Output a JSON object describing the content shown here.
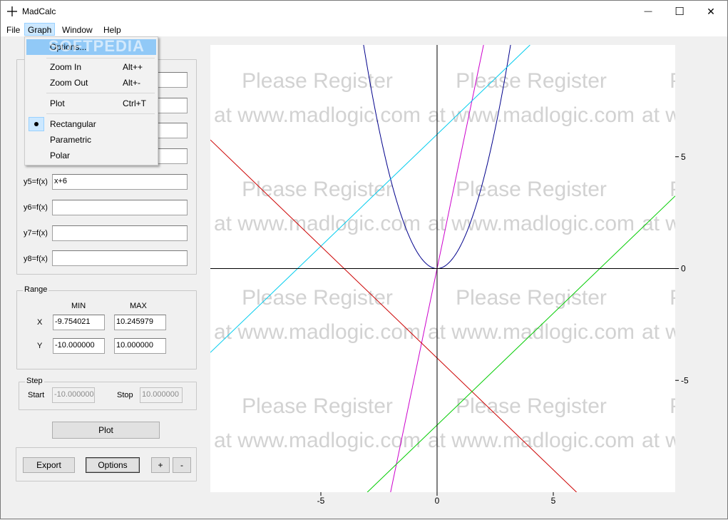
{
  "window": {
    "title": "MadCalc",
    "minimize_glyph": "—",
    "maximize_glyph": "☐",
    "close_glyph": "✕"
  },
  "menubar": [
    "File",
    "Graph",
    "Window",
    "Help"
  ],
  "graph_menu": {
    "items": [
      {
        "label": "Options...",
        "shortcut": ""
      },
      {
        "label": "Zoom In",
        "shortcut": "Alt++"
      },
      {
        "label": "Zoom Out",
        "shortcut": "Alt+-"
      },
      {
        "label": "Plot",
        "shortcut": "Ctrl+T"
      },
      {
        "label": "Rectangular",
        "shortcut": ""
      },
      {
        "label": "Parametric",
        "shortcut": ""
      },
      {
        "label": "Polar",
        "shortcut": ""
      }
    ],
    "checked": "Rectangular",
    "softpedia_watermark": "SOFTPEDIA"
  },
  "functions": {
    "labels": [
      "y5=f(x)",
      "y6=f(x)",
      "y7=f(x)",
      "y8=f(x)"
    ],
    "values": [
      "x+6",
      "",
      "",
      ""
    ]
  },
  "range": {
    "title": "Range",
    "min_label": "MIN",
    "max_label": "MAX",
    "x_label": "X",
    "y_label": "Y",
    "x_min": "-9.754021",
    "x_max": "10.245979",
    "y_min": "-10.000000",
    "y_max": "10.000000"
  },
  "step": {
    "title": "Step",
    "start_label": "Start",
    "start": "-10.000000",
    "stop_label": "Stop",
    "stop": "10.000000"
  },
  "buttons": {
    "plot": "Plot",
    "export": "Export",
    "options": "Options",
    "plus": "+",
    "minus": "-"
  },
  "watermark": {
    "line1": "Please Register",
    "line2": "at www.madlogic.com"
  },
  "colors": {
    "parabola": "#00008b",
    "steep": "#cc00cc",
    "cyan_line": "#00ccee",
    "red_line": "#cc0000",
    "green_line": "#00cc00",
    "axis": "#000000"
  },
  "chart_data": {
    "type": "line",
    "x_range": [
      -9.754021,
      10.245979
    ],
    "y_range": [
      -10,
      10
    ],
    "x_ticks": [
      -5,
      0,
      5
    ],
    "y_ticks": [
      5,
      0,
      -5
    ],
    "series": [
      {
        "color": "#00008b",
        "x": [
          -3.1,
          -3.0,
          -2.5,
          -2.0,
          -1.5,
          -1.0,
          -0.5,
          0,
          0.5,
          1.0,
          1.5,
          2.0,
          2.5,
          3.0,
          3.1
        ],
        "y": [
          9.61,
          9.0,
          6.25,
          4.0,
          2.25,
          1.0,
          0.25,
          0,
          0.25,
          1.0,
          2.25,
          4.0,
          6.25,
          9.0,
          9.61
        ]
      },
      {
        "color": "#cc00cc",
        "x": [
          -2.0,
          2.0
        ],
        "y": [
          -10,
          10
        ]
      },
      {
        "color": "#00ccee",
        "x": [
          -9.754021,
          4.0
        ],
        "y": [
          -3.754021,
          10
        ]
      },
      {
        "color": "#cc0000",
        "x": [
          -9.754021,
          6.0
        ],
        "y": [
          5.754021,
          -10
        ]
      },
      {
        "color": "#00cc00",
        "x": [
          -3.0,
          10.245979
        ],
        "y": [
          -10,
          3.245979
        ]
      }
    ]
  }
}
